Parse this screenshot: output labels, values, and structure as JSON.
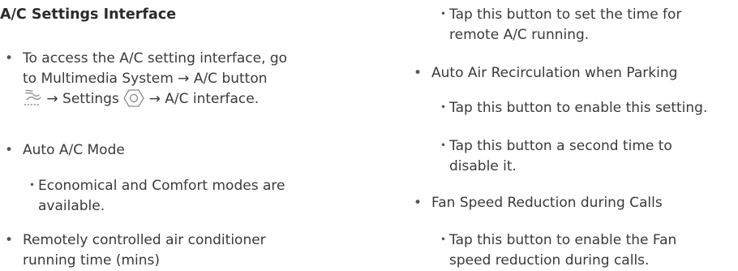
{
  "left": {
    "title": "A/C Settings Interface",
    "bullet1": {
      "line1": "To access the A/C setting interface, go",
      "line2": "to Multimedia System → A/C button",
      "line3_arrow": "→ Settings",
      "line3_end": "→ A/C interface."
    },
    "bullet2": {
      "text": "Auto A/C Mode"
    },
    "sub2": {
      "line1": "Economical and Comfort modes are",
      "line2": "available."
    },
    "bullet3": {
      "line1": "Remotely controlled air conditioner",
      "line2": "running time (mins)"
    }
  },
  "right": {
    "sub1": {
      "line1": "Tap this button to set the time for",
      "line2": "remote A/C running."
    },
    "bullet1": {
      "text": "Auto Air Recirculation when Parking"
    },
    "sub2": {
      "text": "Tap this button to enable this setting."
    },
    "sub3": {
      "line1": "Tap this button a second time to",
      "line2": "disable it."
    },
    "bullet2": {
      "text": "Fan Speed Reduction during Calls"
    },
    "sub4": {
      "line1": "Tap this button to enable the Fan",
      "line2": "speed reduction during calls."
    }
  },
  "icons": {
    "bullet_main": "•",
    "bullet_sub": "・",
    "ac_button_icon": "ac-fan-icon",
    "settings_icon": "settings-gear-icon"
  }
}
